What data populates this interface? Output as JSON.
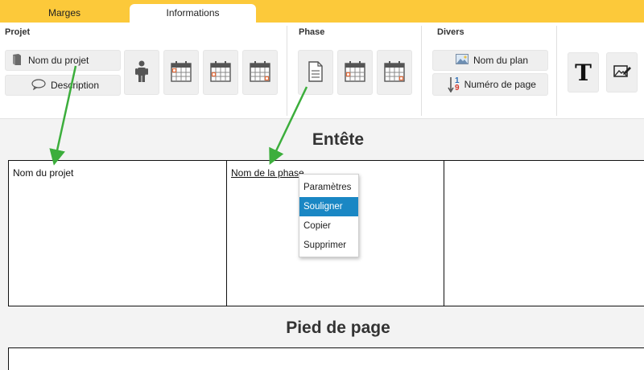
{
  "tabs": [
    {
      "label": "Marges",
      "active": false
    },
    {
      "label": "Informations",
      "active": true
    }
  ],
  "ribbon": {
    "projet": {
      "title": "Projet",
      "nom_du_projet": "Nom du projet",
      "description": "Description",
      "icons": [
        "person-icon",
        "calendar-icon",
        "calendar-icon",
        "calendar-icon"
      ]
    },
    "phase": {
      "title": "Phase",
      "icons": [
        "document-icon",
        "calendar-icon",
        "calendar-icon"
      ]
    },
    "divers": {
      "title": "Divers",
      "nom_du_plan": "Nom du plan",
      "numero_de_page": "Numéro de page",
      "page_number_icon_top": "1",
      "page_number_icon_bottom": "9",
      "text_icon": "T"
    }
  },
  "header": {
    "title": "Entête",
    "cells": [
      "Nom du projet",
      "Nom de la phase",
      ""
    ]
  },
  "footer": {
    "title": "Pied de page"
  },
  "context_menu": {
    "items": [
      "Paramètres",
      "Souligner",
      "Copier",
      "Supprimer"
    ],
    "highlighted_index": 1
  },
  "colors": {
    "tab_bar": "#fcc93a",
    "highlight": "#1a87c4",
    "arrow": "#3cae3c",
    "calendar_accent": "#e46d3c"
  }
}
